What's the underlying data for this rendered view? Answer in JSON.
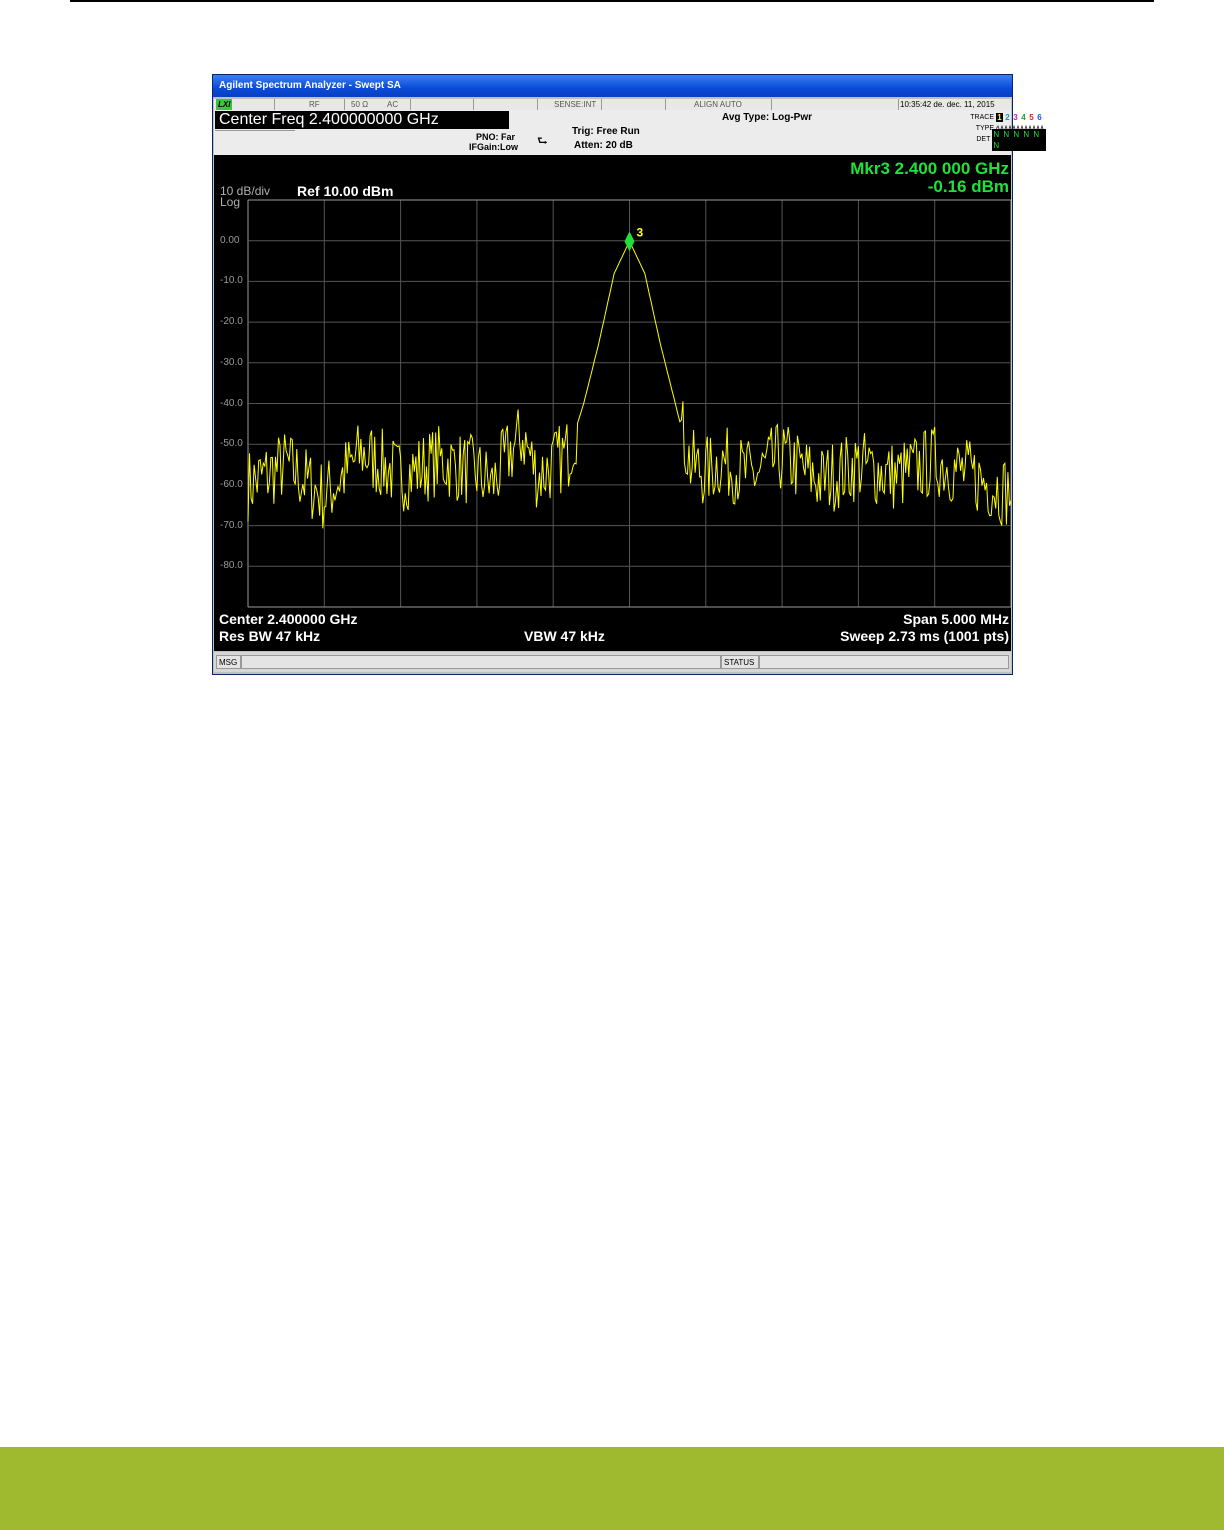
{
  "window": {
    "title": "Agilent Spectrum Analyzer - Swept SA"
  },
  "status_strip": {
    "lxi": "LXI",
    "rf": "RF",
    "impedance": "50 Ω",
    "coupling": "AC",
    "sense": "SENSE:INT",
    "align": "ALIGN AUTO",
    "datetime": "10:35:42 de. dec. 11, 2015"
  },
  "settings": {
    "center_freq": "Center Freq  2.400000000 GHz",
    "pno": "PNO: Far",
    "ifgain": "IFGain:Low",
    "trig": "Trig: Free Run",
    "atten": "Atten: 20 dB",
    "avg_type": "Avg Type: Log-Pwr",
    "trace_label": "TRACE",
    "type_label": "TYPE",
    "det_label": "DET",
    "trace_numbers": [
      "1",
      "2",
      "3",
      "4",
      "5",
      "6"
    ],
    "trace_colors": [
      "#ffff00",
      "#00e0ff",
      "#ff40ff",
      "#40ff40",
      "#ff4040",
      "#4080ff"
    ],
    "det_values": [
      "N",
      "N",
      "N",
      "N",
      "N",
      "N"
    ]
  },
  "display": {
    "scale": "10 dB/div",
    "log": "Log",
    "ref": "Ref 10.00 dBm",
    "marker_freq": "Mkr3 2.400 000 GHz",
    "marker_level": "-0.16 dBm",
    "marker_label": "3",
    "center": "Center 2.400000 GHz",
    "span": "Span 5.000 MHz",
    "rbw": "Res BW 47 kHz",
    "vbw": "VBW 47 kHz",
    "sweep": "Sweep  2.73 ms (1001 pts)",
    "trace_color": "#ffff00",
    "marker_color": "#22e03a"
  },
  "chart_data": {
    "type": "line",
    "xlabel": "",
    "ylabel": "",
    "x_unit": "GHz",
    "xlim": [
      2.3975,
      2.4025
    ],
    "ylim": [
      -90,
      10
    ],
    "y_ticks": [
      "0.00",
      "-10.0",
      "-20.0",
      "-30.0",
      "-40.0",
      "-50.0",
      "-60.0",
      "-70.0",
      "-80.0"
    ],
    "grid": true,
    "series": [
      {
        "x": [
          2.3975,
          2.39775,
          2.398,
          2.39825,
          2.3985,
          2.39875,
          2.399,
          2.3991,
          2.3992,
          2.3993,
          2.3994,
          2.3995,
          2.3996,
          2.3997,
          2.3998,
          2.3999,
          2.4,
          2.4001,
          2.4002,
          2.4003,
          2.4004,
          2.4005,
          2.4006,
          2.4008,
          2.401,
          2.40125,
          2.4015,
          2.40175,
          2.402,
          2.4025
        ],
        "y": [
          -60,
          -55,
          -63,
          -52,
          -58,
          -54,
          -57,
          -60,
          -53,
          -48,
          -58,
          -55,
          -52,
          -40,
          -25,
          -8,
          -0.16,
          -8,
          -25,
          -40,
          -55,
          -57,
          -54,
          -58,
          -53,
          -59,
          -55,
          -58,
          -54,
          -62
        ]
      }
    ],
    "markers": [
      {
        "name": "3",
        "x": 2.4,
        "y": -0.16
      }
    ]
  },
  "msg_bar": {
    "msg": "MSG",
    "status": "STATUS"
  }
}
